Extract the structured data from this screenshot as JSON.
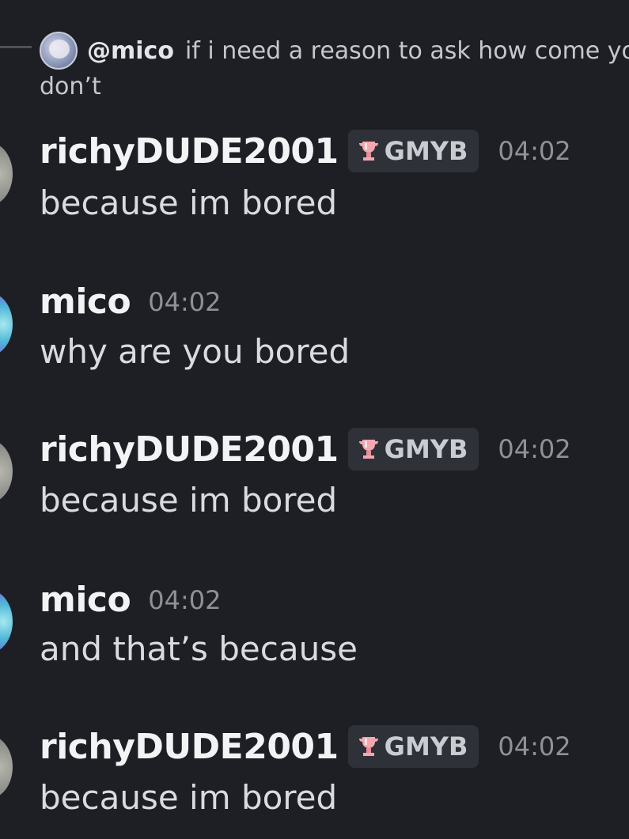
{
  "reply": {
    "author": "@mico",
    "text": "if i need a reason to ask how come yo",
    "continued": "don’t"
  },
  "messages": [
    {
      "author": "richyDUDE2001",
      "tag": "GMYB",
      "time": "04:02",
      "text": "because im bored"
    },
    {
      "author": "mico",
      "tag": "",
      "time": "04:02",
      "text": "why are you bored"
    },
    {
      "author": "richyDUDE2001",
      "tag": "GMYB",
      "time": "04:02",
      "text": "because im bored"
    },
    {
      "author": "mico",
      "tag": "",
      "time": "04:02",
      "text": "and that’s because"
    },
    {
      "author": "richyDUDE2001",
      "tag": "GMYB",
      "time": "04:02",
      "text": "because im bored"
    }
  ],
  "icons": {
    "tag_icon": "trophy-icon",
    "tag_icon_color": "#f4a7b0"
  },
  "colors": {
    "background": "#1e1f24",
    "username": "#f2f3f5",
    "timestamp": "#8e9297",
    "tag_background": "#2f3138"
  }
}
